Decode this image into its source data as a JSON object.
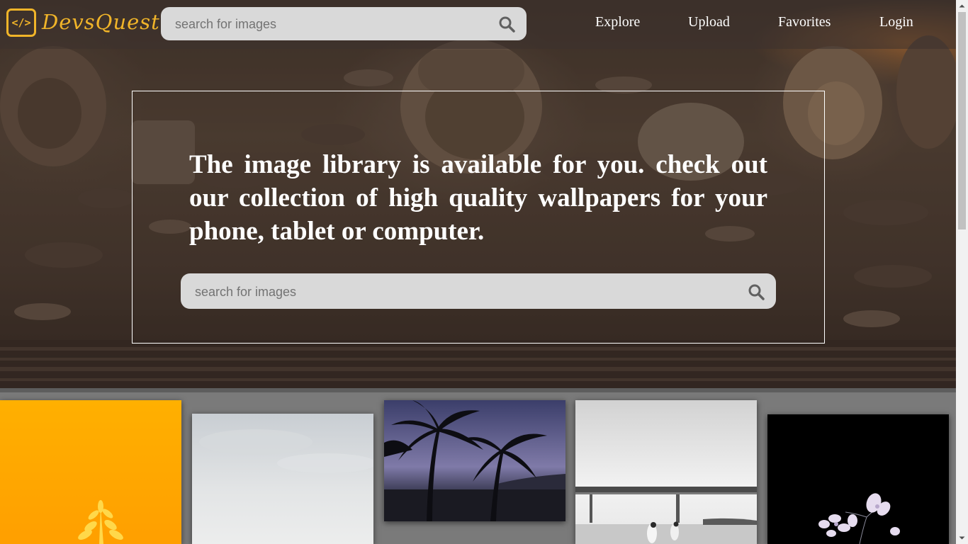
{
  "brand": {
    "name": "DevsQuest",
    "logo_glyph": "</>",
    "accent": "#f0b429"
  },
  "header": {
    "search": {
      "placeholder": "search for images"
    },
    "nav": [
      {
        "label": "Explore"
      },
      {
        "label": "Upload"
      },
      {
        "label": "Favorites"
      },
      {
        "label": "Login"
      }
    ]
  },
  "hero": {
    "text": "The image library is available for you. check out our collection of high quality wallpapers for your phone, tablet or computer.",
    "search": {
      "placeholder": "search for images"
    }
  },
  "gallery": {
    "images": [
      {
        "name": "yellow-plant-image"
      },
      {
        "name": "cloudy-sky-image"
      },
      {
        "name": "palm-trees-dusk-image"
      },
      {
        "name": "bridge-beach-bw-image"
      },
      {
        "name": "white-flowers-black-image"
      }
    ]
  },
  "icons": {
    "search": "search-icon"
  }
}
